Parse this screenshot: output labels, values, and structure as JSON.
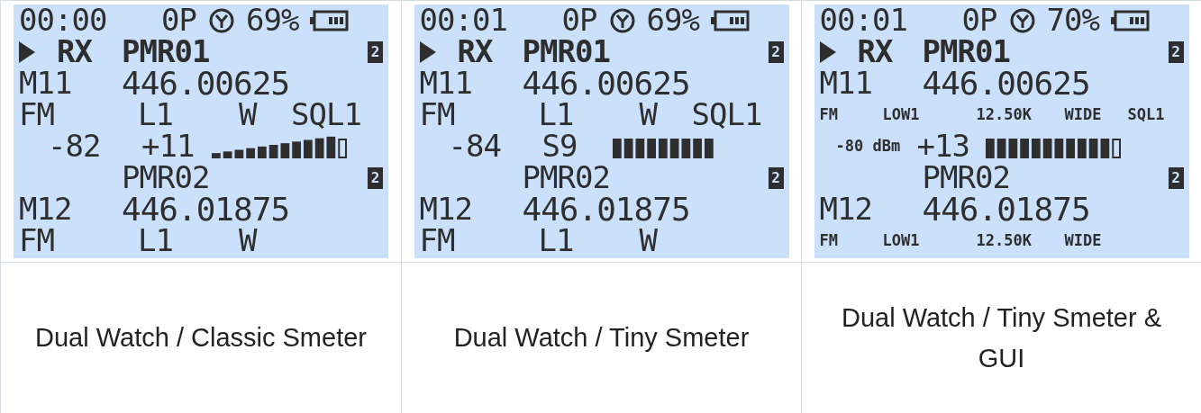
{
  "screens": [
    {
      "status": {
        "time": "00:00",
        "op": "0P",
        "battery": "69%"
      },
      "rx": {
        "mode": "RX",
        "name": "PMR01",
        "badge": "2"
      },
      "vfo1": {
        "channel": "M11",
        "frequency": "446.00625",
        "params": [
          "FM",
          "L1",
          "W",
          "SQL1"
        ]
      },
      "meter": {
        "rssi": "-82",
        "reading": "+11",
        "kind": "classic",
        "level": 0.92
      },
      "vfo2": {
        "name": "PMR02",
        "badge": "2",
        "channel": "M12",
        "frequency": "446.01875",
        "params": [
          "FM",
          "L1",
          "W"
        ]
      },
      "gui": false,
      "caption": "Dual Watch / Classic Smeter"
    },
    {
      "status": {
        "time": "00:01",
        "op": "0P",
        "battery": "69%"
      },
      "rx": {
        "mode": "RX",
        "name": "PMR01",
        "badge": "2"
      },
      "vfo1": {
        "channel": "M11",
        "frequency": "446.00625",
        "params": [
          "FM",
          "L1",
          "W",
          "SQL1"
        ]
      },
      "meter": {
        "rssi": "-84",
        "reading": "S9",
        "kind": "tiny",
        "level": 0.75
      },
      "vfo2": {
        "name": "PMR02",
        "badge": "2",
        "channel": "M12",
        "frequency": "446.01875",
        "params": [
          "FM",
          "L1",
          "W"
        ]
      },
      "gui": false,
      "caption": "Dual Watch / Tiny Smeter"
    },
    {
      "status": {
        "time": "00:01",
        "op": "0P",
        "battery": "70%"
      },
      "rx": {
        "mode": "RX",
        "name": "PMR01",
        "badge": "2"
      },
      "vfo1": {
        "channel": "M11",
        "frequency": "446.00625",
        "params": [
          "FM",
          "LOW1",
          "12.50K",
          "WIDE",
          "SQL1"
        ]
      },
      "meter": {
        "rssi": "-80 dBm",
        "reading": "+13",
        "kind": "gui",
        "level": 0.92
      },
      "vfo2": {
        "name": "PMR02",
        "badge": "2",
        "channel": "M12",
        "frequency": "446.01875",
        "params": [
          "FM",
          "LOW1",
          "12.50K",
          "WIDE"
        ]
      },
      "gui": true,
      "caption": "Dual Watch / Tiny Smeter & GUI"
    }
  ]
}
